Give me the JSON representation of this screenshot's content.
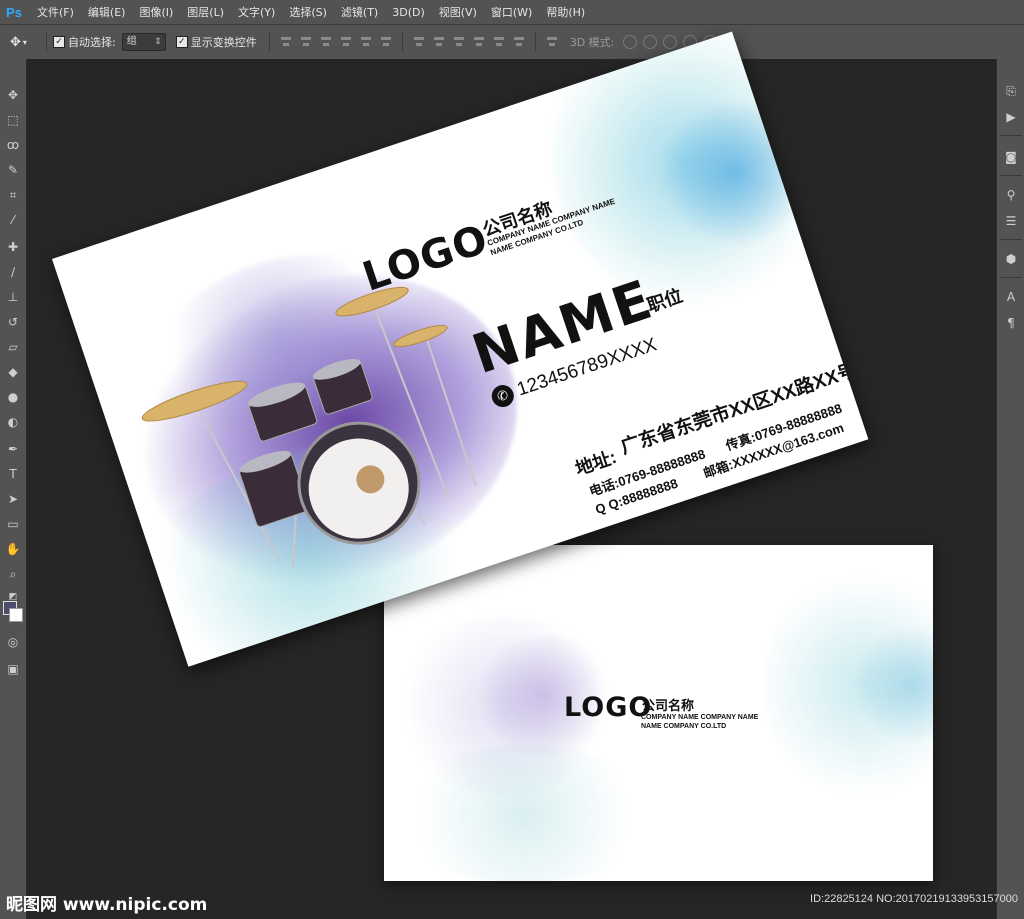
{
  "app": {
    "logo": "Ps"
  },
  "menu": [
    "文件(F)",
    "编辑(E)",
    "图像(I)",
    "图层(L)",
    "文字(Y)",
    "选择(S)",
    "滤镜(T)",
    "3D(D)",
    "视图(V)",
    "窗口(W)",
    "帮助(H)"
  ],
  "options": {
    "auto_select_label": "自动选择:",
    "auto_select_value": "组",
    "show_transform_label": "显示变换控件",
    "mode_3d_label": "3D 模式:"
  },
  "front_card": {
    "logo": "LOGO",
    "company_cn": "公司名称",
    "company_en_1": "COMPANY NAME COMPANY NAME",
    "company_en_2": "NAME COMPANY CO.LTD",
    "name": "NAME",
    "title": "职位",
    "phone": "123456789XXXX",
    "address_label": "地址:",
    "address": "广东省东莞市XX区XX路XX号",
    "tel": "电话:0769-88888888",
    "fax": "传真:0769-88888888",
    "qq": "Q Q:88888888",
    "email": "邮箱:XXXXXX@163.com",
    "colors": {
      "purple": "#5a2d8f",
      "cyan": "#4fb7d6",
      "teal": "#7fd0c8"
    }
  },
  "back_card": {
    "logo": "LOGO",
    "company_cn": "公司名称",
    "company_en_1": "COMPANY NAME COMPANY NAME",
    "company_en_2": "NAME COMPANY CO.LTD"
  },
  "watermark": {
    "site": "昵图网 www.nipic.com",
    "id": "ID:22825124 NO:20170219133953157000"
  }
}
